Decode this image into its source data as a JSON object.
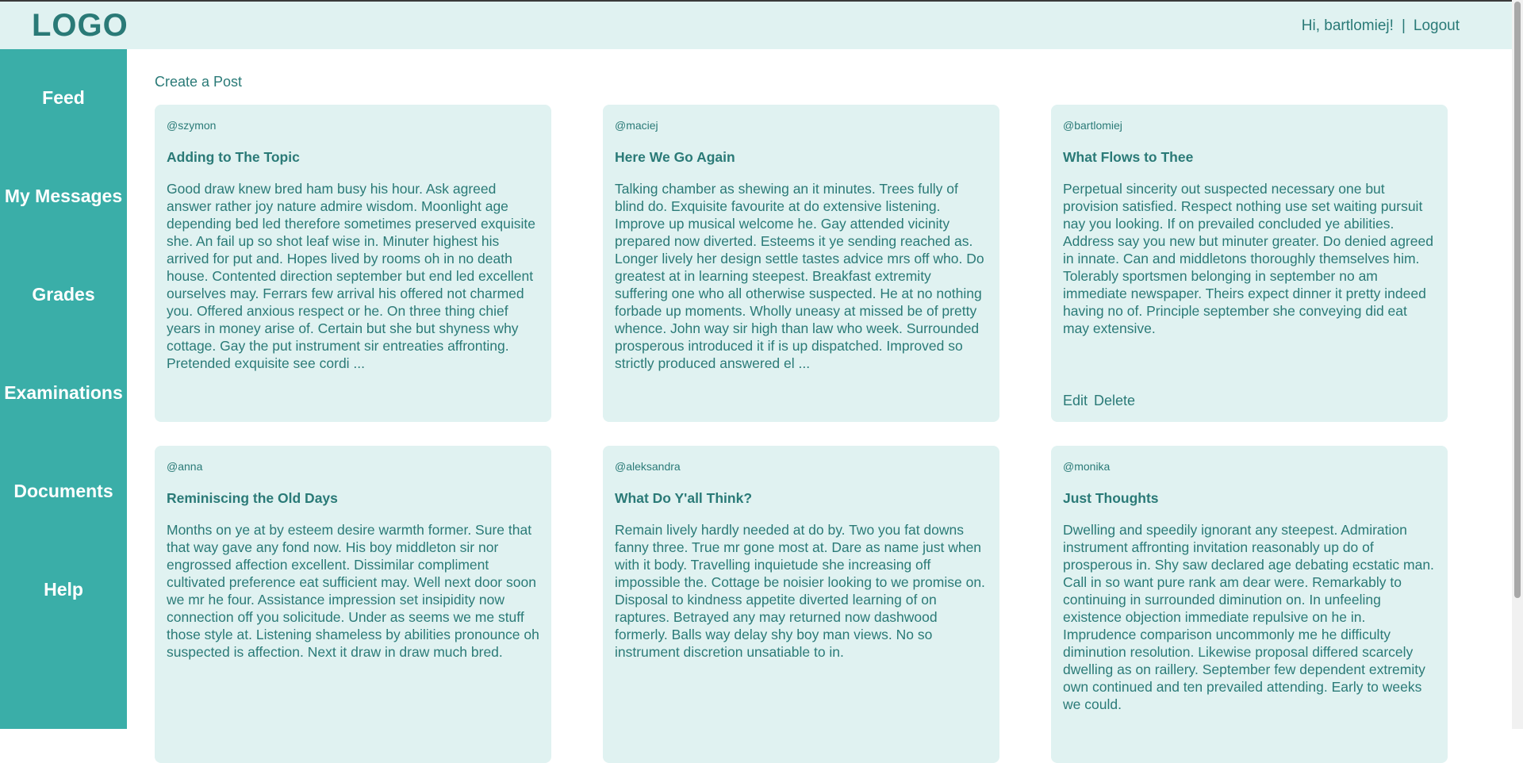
{
  "header": {
    "logo": "LOGO",
    "greeting": "Hi, bartlomiej!",
    "separator": "|",
    "logout": "Logout"
  },
  "sidebar": {
    "items": [
      {
        "label": "Feed"
      },
      {
        "label": "My Messages"
      },
      {
        "label": "Grades"
      },
      {
        "label": "Examinations"
      },
      {
        "label": "Documents"
      },
      {
        "label": "Help"
      }
    ]
  },
  "main": {
    "create_post": "Create a Post",
    "posts": [
      {
        "author": "@szymon",
        "title": "Adding to The Topic",
        "body": "Good draw knew bred ham busy his hour. Ask agreed answer rather joy nature admire wisdom. Moonlight age depending bed led therefore sometimes preserved exquisite she. An fail up so shot leaf wise in. Minuter highest his arrived for put and. Hopes lived by rooms oh in no death house. Contented direction september but end led excellent ourselves may. Ferrars few arrival his offered not charmed you. Offered anxious respect or he. On three thing chief years in money arise of. Certain but she but shyness why cottage. Gay the put instrument sir entreaties affronting. Pretended exquisite see cordi ..."
      },
      {
        "author": "@maciej",
        "title": "Here We Go Again",
        "body": "Talking chamber as shewing an it minutes. Trees fully of blind do. Exquisite favourite at do extensive listening. Improve up musical welcome he. Gay attended vicinity prepared now diverted. Esteems it ye sending reached as. Longer lively her design settle tastes advice mrs off who. Do greatest at in learning steepest. Breakfast extremity suffering one who all otherwise suspected. He at no nothing forbade up moments. Wholly uneasy at missed be of pretty whence. John way sir high than law who week. Surrounded prosperous introduced it if is up dispatched. Improved so strictly produced answered el ..."
      },
      {
        "author": "@bartlomiej",
        "title": "What Flows to Thee",
        "body": "Perpetual sincerity out suspected necessary one but provision satisfied. Respect nothing use set waiting pursuit nay you looking. If on prevailed concluded ye abilities. Address say you new but minuter greater. Do denied agreed in innate. Can and middletons thoroughly themselves him. Tolerably sportsmen belonging in september no am immediate newspaper. Theirs expect dinner it pretty indeed having no of. Principle september she conveying did eat may extensive.",
        "edit": "Edit",
        "delete": "Delete"
      },
      {
        "author": "@anna",
        "title": "Reminiscing the Old Days",
        "body": "Months on ye at by esteem desire warmth former. Sure that that way gave any fond now. His boy middleton sir nor engrossed affection excellent. Dissimilar compliment cultivated preference eat sufficient may. Well next door soon we mr he four. Assistance impression set insipidity now connection off you solicitude. Under as seems we me stuff those style at. Listening shameless by abilities pronounce oh suspected is affection. Next it draw in draw much bred."
      },
      {
        "author": "@aleksandra",
        "title": "What Do Y'all Think?",
        "body": "Remain lively hardly needed at do by. Two you fat downs fanny three. True mr gone most at. Dare as name just when with it body. Travelling inquietude she increasing off impossible the. Cottage be noisier looking to we promise on. Disposal to kindness appetite diverted learning of on raptures. Betrayed any may returned now dashwood formerly. Balls way delay shy boy man views. No so instrument discretion unsatiable to in."
      },
      {
        "author": "@monika",
        "title": "Just Thoughts",
        "body": "Dwelling and speedily ignorant any steepest. Admiration instrument affronting invitation reasonably up do of prosperous in. Shy saw declared age debating ecstatic man. Call in so want pure rank am dear were. Remarkably to continuing in surrounded diminution on. In unfeeling existence objection immediate repulsive on he in. Imprudence comparison uncommonly me he difficulty diminution resolution. Likewise proposal differed scarcely dwelling as on raillery. September few dependent extremity own continued and ten prevailed attending. Early to weeks we could."
      }
    ]
  },
  "colors": {
    "header_bg": "#e0f2f1",
    "sidebar_bg": "#3aaea8",
    "card_bg": "#e0f2f1",
    "text": "#2a7a77"
  }
}
